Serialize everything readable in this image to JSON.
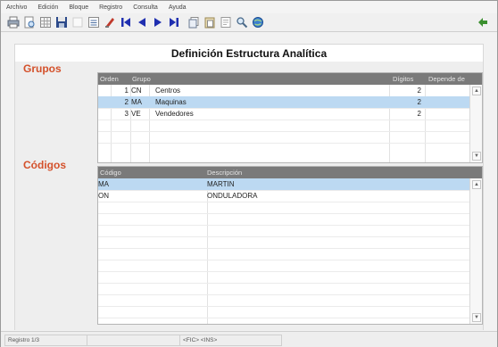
{
  "menu": {
    "items": [
      "Archivo",
      "Edición",
      "Bloque",
      "Registro",
      "Consulta",
      "Ayuda"
    ]
  },
  "toolbar": {
    "icons": [
      "print-icon",
      "preview-icon",
      "grid-icon",
      "save-icon",
      "blank-icon",
      "list-icon",
      "delete-icon",
      "first-record-icon",
      "previous-record-icon",
      "next-record-icon",
      "last-record-icon",
      "copy-icon",
      "paste-icon",
      "form-icon",
      "search-icon",
      "web-icon",
      "exit-icon"
    ],
    "colors": {
      "navy": "#1f2fb0",
      "red": "#c0392b",
      "green": "#3a8f2e"
    }
  },
  "page": {
    "title": "Definición Estructura Analítica"
  },
  "groups": {
    "label": "Grupos",
    "columns": [
      "Orden",
      "Grupo",
      "",
      "Dígitos",
      "Depende de"
    ],
    "rows": [
      {
        "orden": "1",
        "grupo": "CN",
        "nombre": "Centros",
        "digitos": "2",
        "depende": ""
      },
      {
        "orden": "2",
        "grupo": "MA",
        "nombre": "Maquinas",
        "digitos": "2",
        "depende": ""
      },
      {
        "orden": "3",
        "grupo": "VE",
        "nombre": "Vendedores",
        "digitos": "2",
        "depende": ""
      }
    ],
    "selected_row": 1
  },
  "codes": {
    "label": "Códigos",
    "columns": [
      "Código",
      "Descripción"
    ],
    "rows": [
      {
        "codigo": "MA",
        "descripcion": "MARTIN"
      },
      {
        "codigo": "ON",
        "descripcion": "ONDULADORA"
      }
    ],
    "selected_row": 0
  },
  "status": {
    "record": "Registro 1/3",
    "mode": "",
    "keys": "<FIC> <INS>"
  },
  "colors": {
    "section_label": "#d4512b",
    "header": "#7a7a7a",
    "selection": "#bcd9f2"
  }
}
